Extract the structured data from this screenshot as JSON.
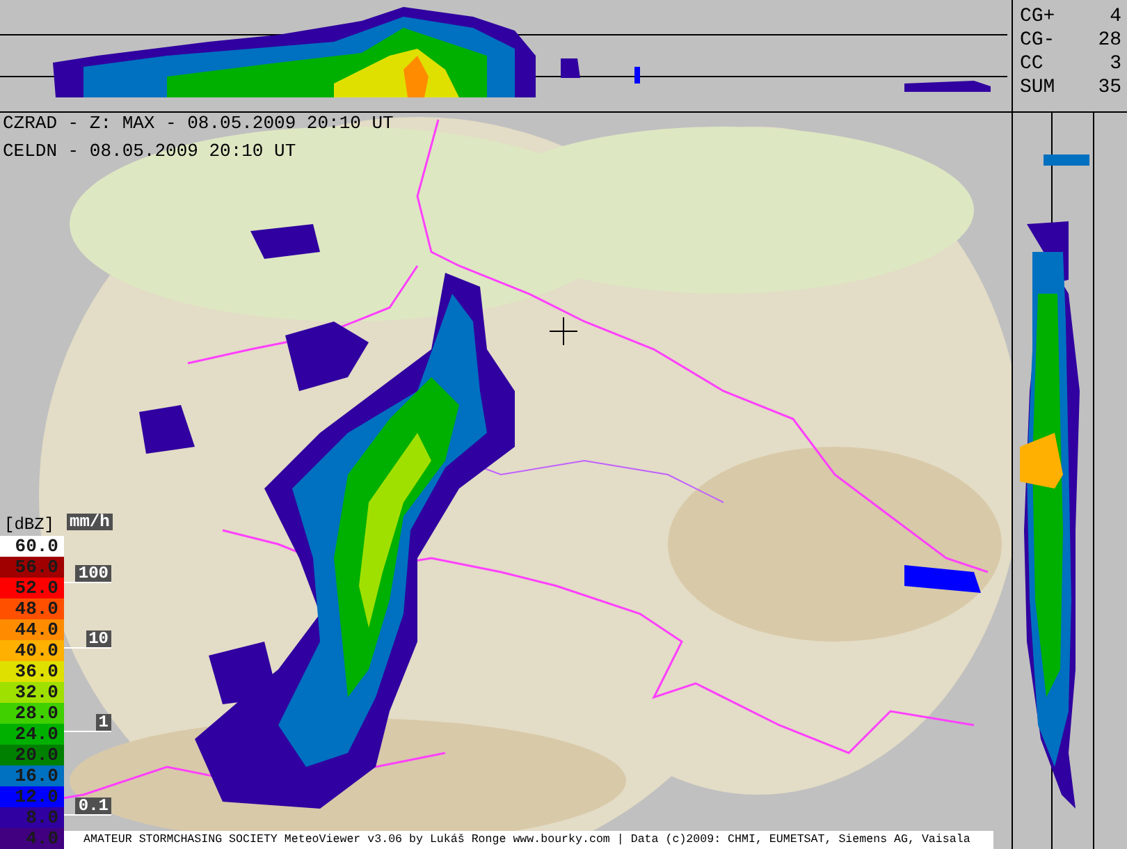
{
  "header_lines": [
    "CZRAD - Z: MAX - 08.05.2009 20:10 UT",
    "CELDN - 08.05.2009 20:10 UT"
  ],
  "lightning_stats": [
    {
      "label": "CG+",
      "value": "4"
    },
    {
      "label": "CG-",
      "value": "28"
    },
    {
      "label": "CC",
      "value": "3"
    },
    {
      "label": "SUM",
      "value": "35"
    }
  ],
  "legend": {
    "unit": "[dBZ]",
    "steps": [
      {
        "label": "60.0",
        "color": "#ffffff"
      },
      {
        "label": "56.0",
        "color": "#a00000"
      },
      {
        "label": "52.0",
        "color": "#ff0000"
      },
      {
        "label": "48.0",
        "color": "#ff5000"
      },
      {
        "label": "44.0",
        "color": "#ff8c00"
      },
      {
        "label": "40.0",
        "color": "#ffb000"
      },
      {
        "label": "36.0",
        "color": "#e0e000"
      },
      {
        "label": "32.0",
        "color": "#a0e000"
      },
      {
        "label": "28.0",
        "color": "#40d000"
      },
      {
        "label": "24.0",
        "color": "#00b000"
      },
      {
        "label": "20.0",
        "color": "#008000"
      },
      {
        "label": "16.0",
        "color": "#0070c0"
      },
      {
        "label": "12.0",
        "color": "#0000ff"
      },
      {
        "label": "8.0",
        "color": "#3000a0"
      },
      {
        "label": "4.0",
        "color": "#400080"
      }
    ]
  },
  "rain_scale": {
    "unit": "mm/h",
    "marks": [
      "100",
      "10",
      "1",
      "0.1"
    ]
  },
  "footer": "AMATEUR STORMCHASING SOCIETY MeteoViewer v3.06 by Lukáš Ronge www.bourky.com | Data (c)2009: CHMI, EUMETSAT, Siemens AG, Vaisala"
}
